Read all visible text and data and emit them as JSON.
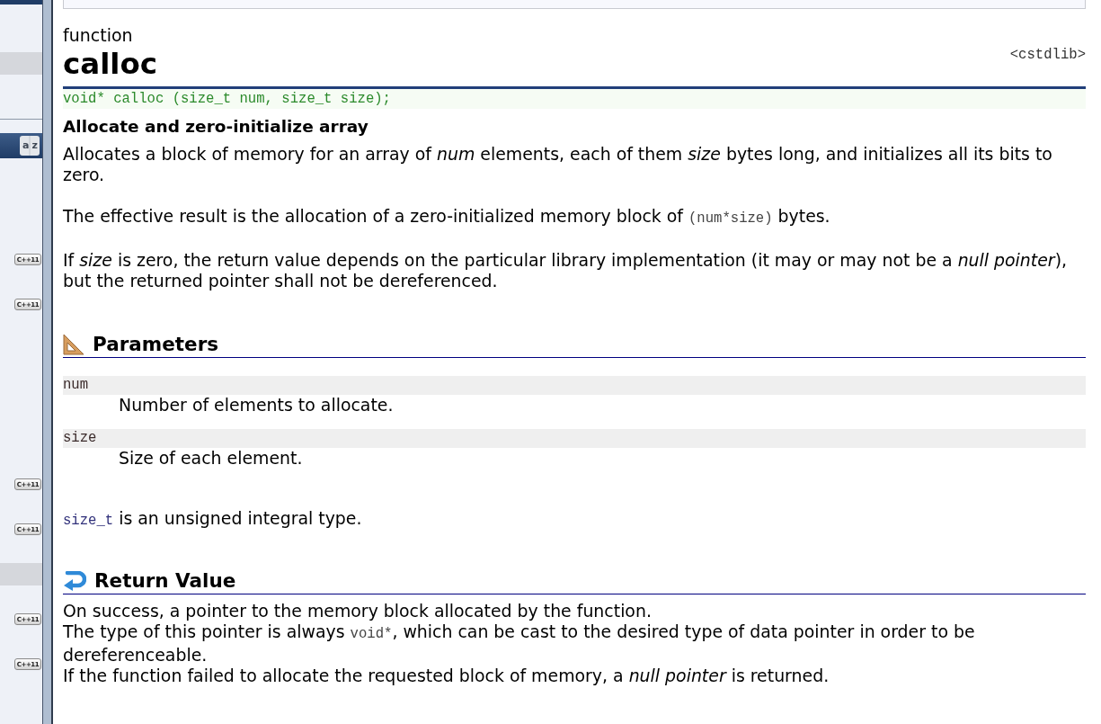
{
  "sidebar": {
    "items": [
      {
        "kind": "header"
      },
      {
        "kind": "row",
        "selected": false
      },
      {
        "kind": "row",
        "selected": false
      },
      {
        "kind": "row",
        "selected": true
      },
      {
        "kind": "row",
        "selected": false
      },
      {
        "kind": "row",
        "selected": false
      },
      {
        "kind": "header",
        "sort_label": "az"
      },
      {
        "kind": "row",
        "selected": false
      },
      {
        "kind": "row",
        "selected": false
      },
      {
        "kind": "row",
        "selected": false
      },
      {
        "kind": "row",
        "selected": false
      },
      {
        "kind": "row",
        "selected": false,
        "badge": "C++11"
      },
      {
        "kind": "row",
        "selected": false
      },
      {
        "kind": "row",
        "selected": false,
        "badge": "C++11"
      },
      {
        "kind": "row",
        "selected": false
      },
      {
        "kind": "row",
        "selected": false
      },
      {
        "kind": "row",
        "selected": false
      },
      {
        "kind": "row",
        "selected": false
      },
      {
        "kind": "row",
        "selected": false
      },
      {
        "kind": "row",
        "selected": false
      },
      {
        "kind": "row",
        "selected": false
      },
      {
        "kind": "row",
        "selected": false,
        "badge": "C++11"
      },
      {
        "kind": "row",
        "selected": false
      },
      {
        "kind": "row",
        "selected": false,
        "badge": "C++11"
      },
      {
        "kind": "row",
        "selected": false
      },
      {
        "kind": "row",
        "selected": true
      },
      {
        "kind": "row",
        "selected": false
      },
      {
        "kind": "row",
        "selected": false,
        "badge": "C++11"
      },
      {
        "kind": "row",
        "selected": false
      },
      {
        "kind": "row",
        "selected": false,
        "badge": "C++11"
      },
      {
        "kind": "row",
        "selected": false
      },
      {
        "kind": "row",
        "selected": false
      }
    ]
  },
  "entry": {
    "kind_label": "function",
    "name": "calloc",
    "header": "<cstdlib>",
    "prototype": "void* calloc (size_t num, size_t size);",
    "summary": "Allocate and zero-initialize array",
    "paragraphs": [
      [
        {
          "kind": "text",
          "text": "Allocates a block of memory for an array of *num* elements, each of them *size* bytes long, and initializes all its bits to zero."
        }
      ],
      [
        {
          "kind": "text",
          "text": "The effective result is the allocation of a zero-initialized memory block of "
        },
        {
          "kind": "code",
          "text": "(num*size)"
        },
        {
          "kind": "text",
          "text": " bytes."
        }
      ],
      [
        {
          "kind": "text",
          "text": "If *size* is zero, the return value depends on the particular library implementation (it may or may not be a *null pointer*), but the returned pointer shall not be dereferenced."
        }
      ]
    ]
  },
  "parameters": {
    "heading": "Parameters",
    "items": [
      {
        "name": "num",
        "description": "Number of elements to allocate."
      },
      {
        "name": "size",
        "description": "Size of each element."
      }
    ],
    "note": [
      {
        "kind": "link",
        "text": "size_t"
      },
      {
        "kind": "text",
        "text": " is an unsigned integral type."
      }
    ]
  },
  "return_value": {
    "heading": "Return Value",
    "lines": [
      [
        {
          "kind": "text",
          "text": "On success, a pointer to the memory block allocated by the function."
        }
      ],
      [
        {
          "kind": "text",
          "text": "The type of this pointer is always "
        },
        {
          "kind": "code",
          "text": "void*"
        },
        {
          "kind": "text",
          "text": ", which can be cast to the desired type of data pointer in order to be dereferenceable."
        }
      ],
      [
        {
          "kind": "text",
          "text": "If the function failed to allocate the requested block of memory, a *null pointer* is returned."
        }
      ]
    ]
  }
}
